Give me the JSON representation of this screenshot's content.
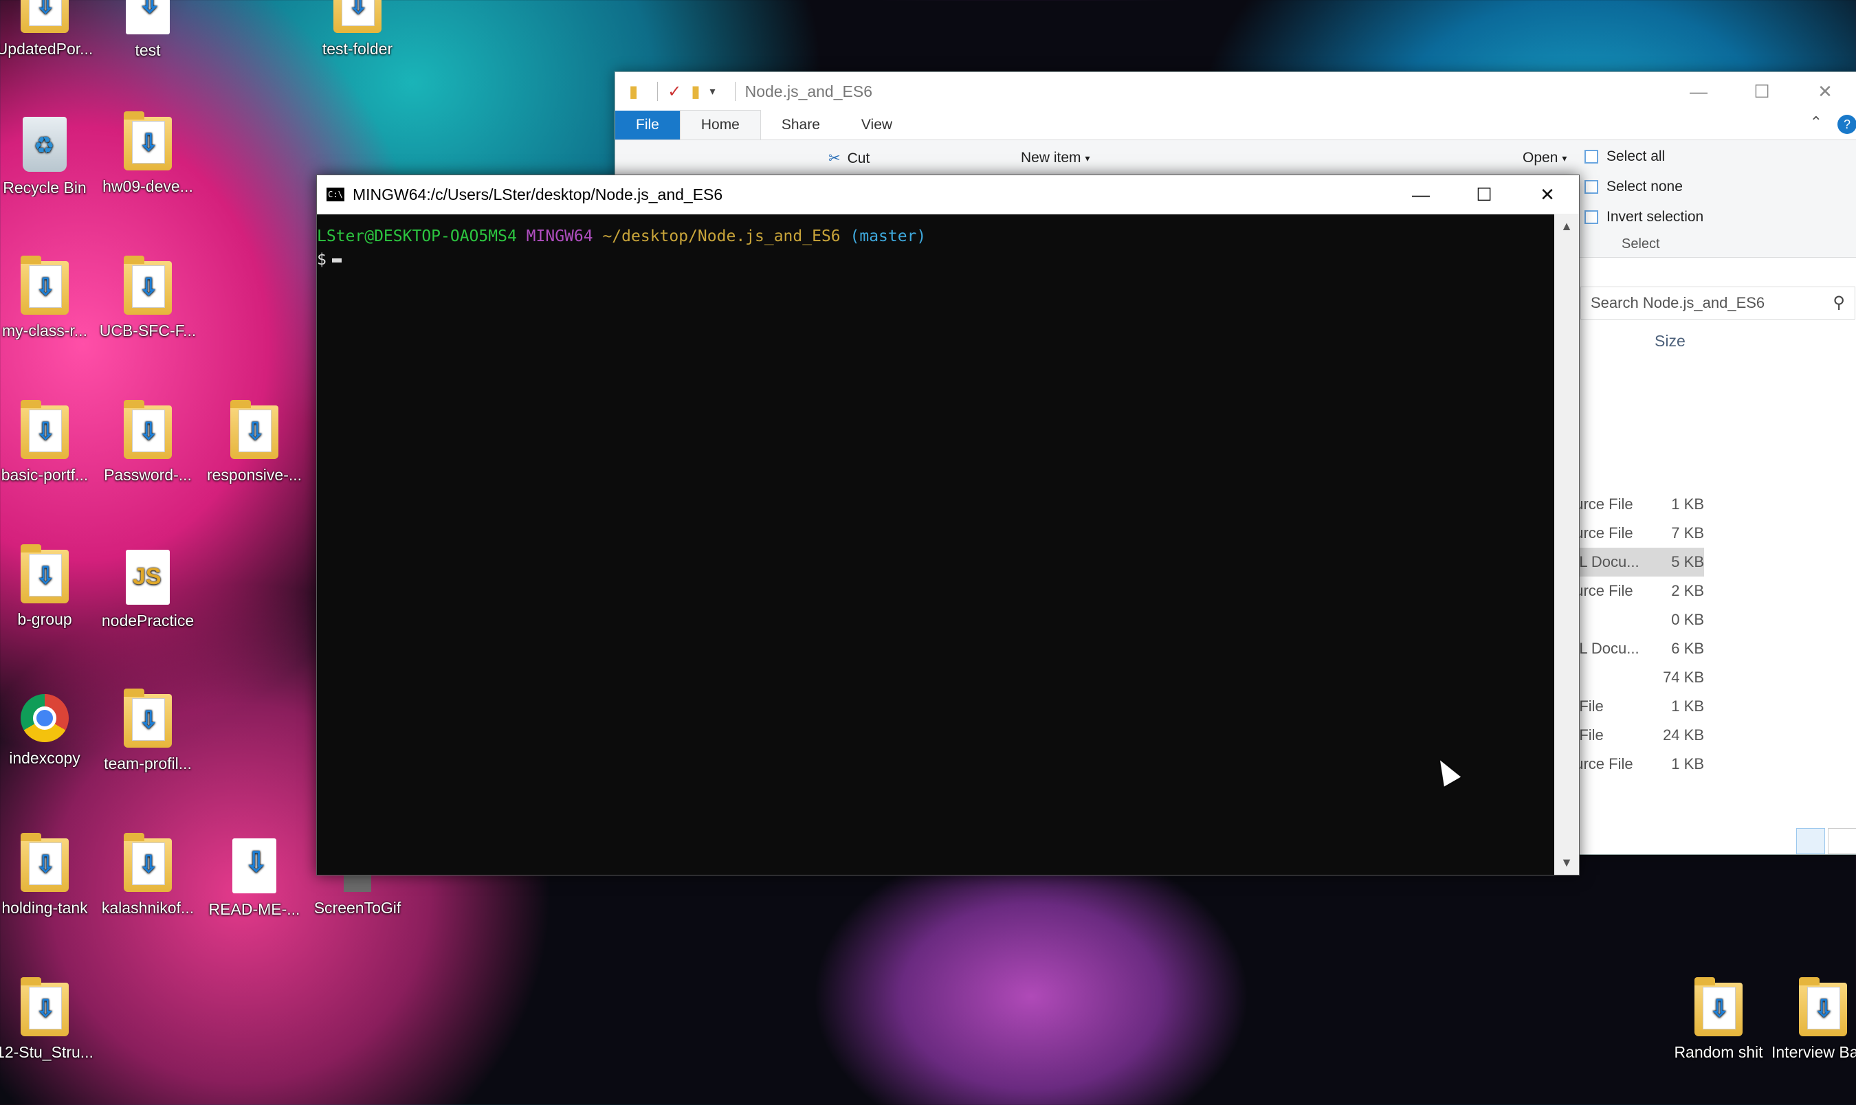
{
  "desktop": {
    "icons": [
      {
        "label": "UpdatedPor...",
        "kind": "folder"
      },
      {
        "label": "test",
        "kind": "doc"
      },
      {
        "label": "test-folder",
        "kind": "folder"
      },
      {
        "label": "Recycle Bin",
        "kind": "recycle"
      },
      {
        "label": "hw09-deve...",
        "kind": "folder"
      },
      {
        "label": "my-class-r...",
        "kind": "folder"
      },
      {
        "label": "UCB-SFC-F...",
        "kind": "folder"
      },
      {
        "label": "basic-portf...",
        "kind": "folder"
      },
      {
        "label": "Password-...",
        "kind": "folder"
      },
      {
        "label": "responsive-...",
        "kind": "folder"
      },
      {
        "label": "b-group",
        "kind": "folder"
      },
      {
        "label": "nodePractice",
        "kind": "js"
      },
      {
        "label": "indexcopy",
        "kind": "chrome"
      },
      {
        "label": "team-profil...",
        "kind": "folder"
      },
      {
        "label": "holding-tank",
        "kind": "folder"
      },
      {
        "label": "kalashnikof...",
        "kind": "folder"
      },
      {
        "label": "READ-ME-...",
        "kind": "doc"
      },
      {
        "label": "ScreenToGif",
        "kind": "app"
      },
      {
        "label": "12-Stu_Stru...",
        "kind": "folder"
      },
      {
        "label": "Random shit",
        "kind": "folder"
      },
      {
        "label": "Interview Basics",
        "kind": "folder"
      }
    ]
  },
  "explorer": {
    "title": "Node.js_and_ES6",
    "tabs": [
      "File",
      "Home",
      "Share",
      "View"
    ],
    "ribbon": {
      "cut": "Cut",
      "new_item": "New item",
      "open": "Open",
      "select_all": "Select all",
      "select_none": "Select none",
      "invert_selection": "Invert selection",
      "select_group": "Select"
    },
    "search_placeholder": "Search Node.js_and_ES6",
    "column_size": "Size",
    "rows": [
      {
        "type": "ource File",
        "size": "1 KB"
      },
      {
        "type": "ource File",
        "size": "7 KB"
      },
      {
        "type": "ML Docu...",
        "size": "5 KB"
      },
      {
        "type": "ource File",
        "size": "2 KB"
      },
      {
        "type": "",
        "size": "0 KB"
      },
      {
        "type": "ML Docu...",
        "size": "6 KB"
      },
      {
        "type": "",
        "size": "74 KB"
      },
      {
        "type": "e File",
        "size": "1 KB"
      },
      {
        "type": "e File",
        "size": "24 KB"
      },
      {
        "type": "ource File",
        "size": "1 KB"
      }
    ]
  },
  "terminal": {
    "title": "MINGW64:/c/Users/LSter/desktop/Node.js_and_ES6",
    "prompt_user": "LSter@DESKTOP-OAO5MS4",
    "prompt_env": "MINGW64",
    "prompt_path": "~/desktop/Node.js_and_ES6",
    "prompt_branch": "(master)",
    "prompt_symbol": "$"
  }
}
